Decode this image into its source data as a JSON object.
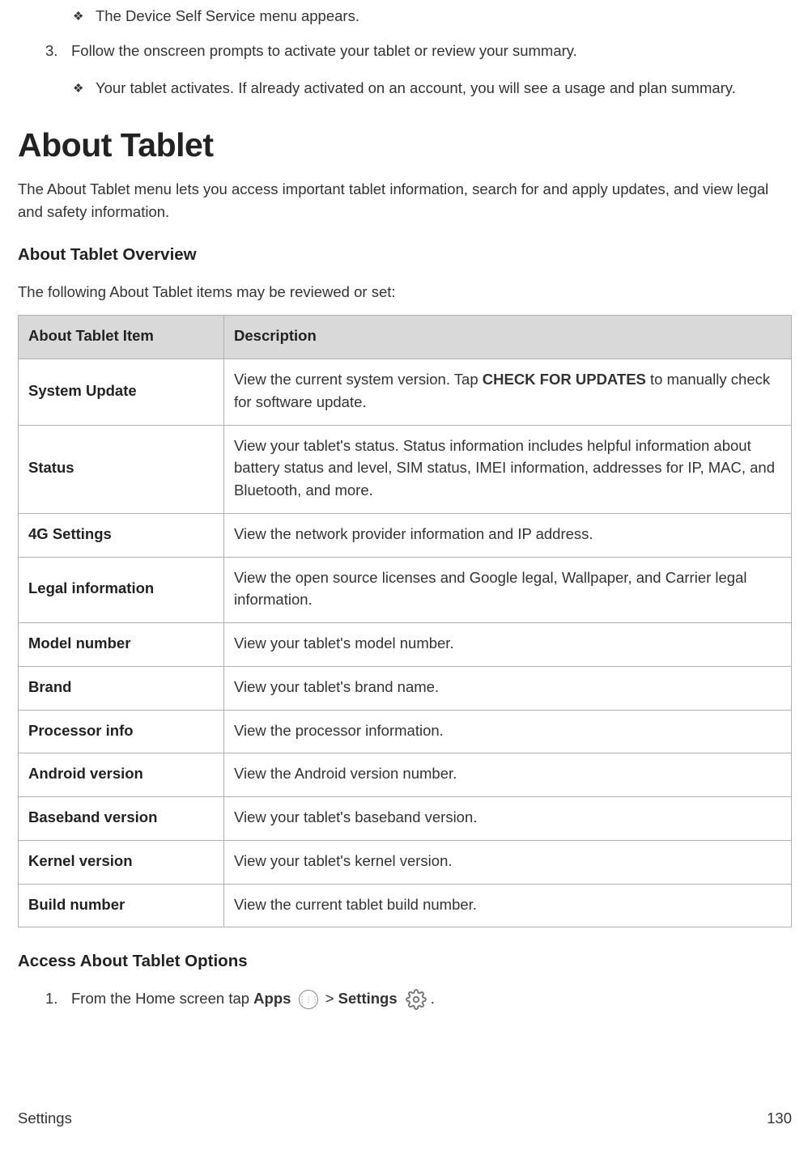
{
  "top_bullets": {
    "b1": "The Device Self Service menu appears.",
    "step3_num": "3.",
    "step3_text": "Follow the onscreen prompts to activate your tablet or review your summary.",
    "b2": "Your tablet activates. If already activated on an account, you will see a usage and plan summary."
  },
  "h1": "About Tablet",
  "intro": "The About Tablet menu lets you access important tablet information, search for and apply updates, and view legal and safety information.",
  "h2_overview": "About Tablet Overview",
  "overview_lead": "The following About Tablet items may be reviewed or set:",
  "table": {
    "headers": {
      "col1": "About Tablet Item",
      "col2": "Description"
    },
    "rows": [
      {
        "item": "System Update",
        "desc_pre": "View the current system version. Tap ",
        "desc_bold": "CHECK FOR UPDATES",
        "desc_post": " to manually check for software update."
      },
      {
        "item": "Status",
        "desc": "View your tablet's status. Status information includes helpful information about battery status and level, SIM status, IMEI information, addresses for IP, MAC, and Bluetooth, and more."
      },
      {
        "item": "4G Settings",
        "desc": "View the network provider information and IP address."
      },
      {
        "item": "Legal information",
        "desc": "View the open source licenses and Google legal, Wallpaper, and Carrier legal information."
      },
      {
        "item": "Model number",
        "desc": "View your tablet's model number."
      },
      {
        "item": "Brand",
        "desc": "View your tablet's brand name."
      },
      {
        "item": "Processor info",
        "desc": "View the processor information."
      },
      {
        "item": "Android version",
        "desc": "View the Android version number."
      },
      {
        "item": "Baseband version",
        "desc": "View your tablet's baseband version."
      },
      {
        "item": "Kernel version",
        "desc": "View your tablet's kernel version."
      },
      {
        "item": "Build number",
        "desc": "View the current tablet build number."
      }
    ]
  },
  "h2_access": "Access About Tablet Options",
  "access_step1": {
    "num": "1.",
    "pre": "From the Home screen tap ",
    "apps": "Apps",
    "sep": " > ",
    "settings": "Settings",
    "end": "."
  },
  "footer": {
    "section": "Settings",
    "page": "130"
  },
  "icons": {
    "diamond": "❖"
  }
}
